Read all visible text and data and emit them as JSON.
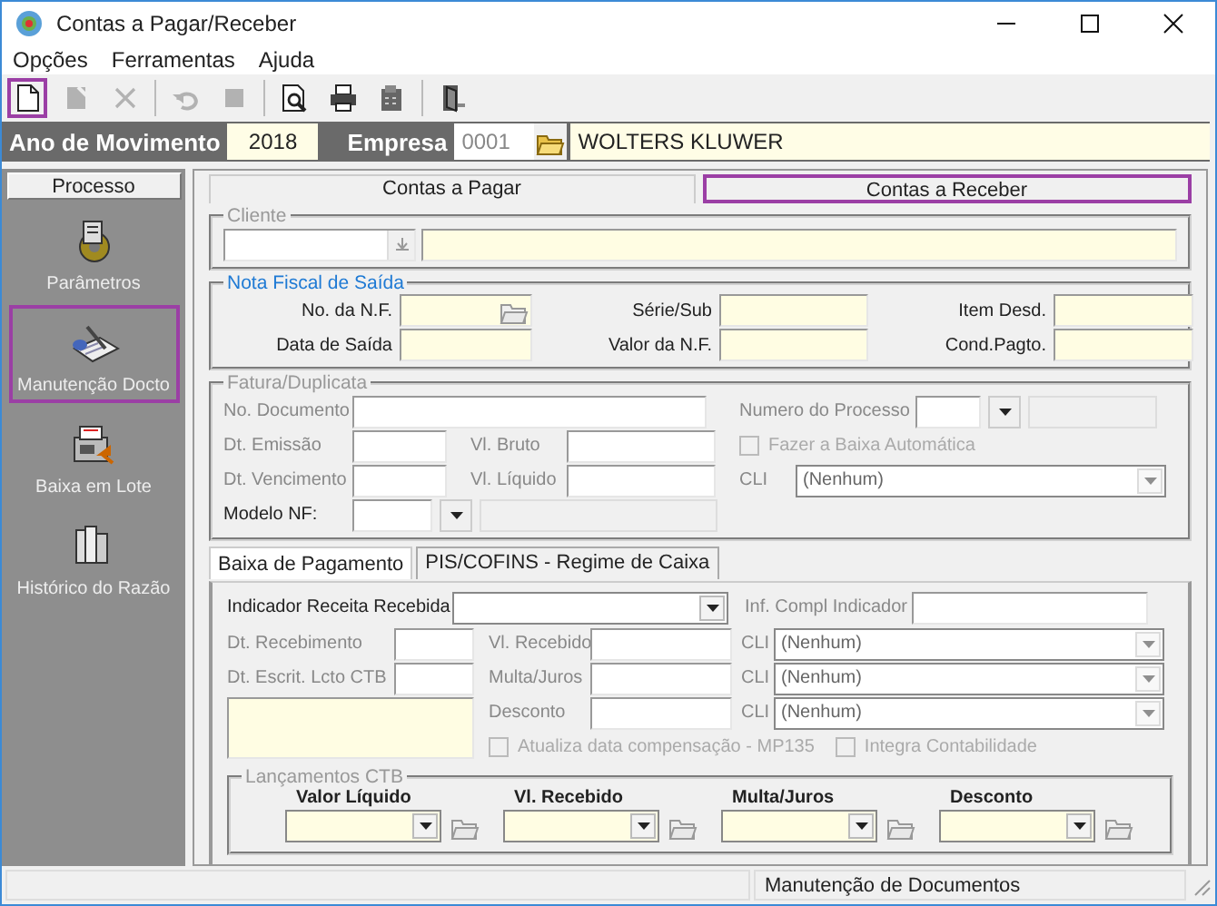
{
  "window": {
    "title": "Contas a Pagar/Receber"
  },
  "menu": [
    "Opções",
    "Ferramentas",
    "Ajuda"
  ],
  "toolbar": [
    {
      "kind": "new",
      "disabled": false,
      "selected": true
    },
    {
      "kind": "edit",
      "disabled": true,
      "selected": false
    },
    {
      "kind": "delete",
      "disabled": true,
      "selected": false
    },
    {
      "kind": "separator"
    },
    {
      "kind": "undo",
      "disabled": true,
      "selected": false
    },
    {
      "kind": "stop",
      "disabled": true,
      "selected": false
    },
    {
      "kind": "separator"
    },
    {
      "kind": "preview",
      "disabled": false,
      "selected": false
    },
    {
      "kind": "print",
      "disabled": false,
      "selected": false
    },
    {
      "kind": "calculator",
      "disabled": false,
      "selected": false
    },
    {
      "kind": "separator"
    },
    {
      "kind": "exit",
      "disabled": false,
      "selected": false
    }
  ],
  "header": {
    "year_label": "Ano de Movimento",
    "year": "2018",
    "company_label": "Empresa",
    "company_code": "0001",
    "company_name": "WOLTERS KLUWER"
  },
  "sidebar": {
    "title": "Processo",
    "items": [
      {
        "label": "Parâmetros",
        "kind": "gear",
        "selected": false
      },
      {
        "label": "Manutenção Docto",
        "kind": "notepad",
        "selected": true
      },
      {
        "label": "Baixa em Lote",
        "kind": "machine",
        "selected": false
      },
      {
        "label": "Histórico do Razão",
        "kind": "books",
        "selected": false
      }
    ]
  },
  "tabs": [
    {
      "label": "Contas a Pagar",
      "selected": false
    },
    {
      "label": "Contas a Receber",
      "selected": true
    }
  ],
  "cliente": {
    "legend": "Cliente",
    "disabled": true
  },
  "nota_fiscal": {
    "legend": "Nota Fiscal de Saída",
    "fields": [
      {
        "label": "No. da N.F."
      },
      {
        "label": "Série/Sub"
      },
      {
        "label": "Item Desd."
      },
      {
        "label": "Data de Saída"
      },
      {
        "label": "Valor da N.F."
      },
      {
        "label": "Cond.Pagto."
      }
    ]
  },
  "fatura": {
    "legend": "Fatura/Duplicata",
    "disabled": true,
    "document_label": "No. Documento",
    "process_label": "Numero do Processo",
    "issue_label": "Dt. Emissão",
    "gross_label": "Vl. Bruto",
    "auto_settle": {
      "label": "Fazer a Baixa Automática",
      "checked": false,
      "disabled": true
    },
    "due_label": "Dt. Vencimento",
    "net_label": "Vl. Líquido",
    "cli_label": "CLI",
    "cli_value": "(Nenhum)",
    "model_label": "Modelo NF:"
  },
  "sub_tabs": [
    {
      "label": "Baixa de Pagamento",
      "selected": true
    },
    {
      "label": "PIS/COFINS - Regime de Caixa",
      "selected": false
    }
  ],
  "baixa": {
    "indicator_label": "Indicador Receita Recebida",
    "compl_label": "Inf. Compl Indicador",
    "rows": [
      {
        "date_label": "Dt. Recebimento",
        "amount_label": "Vl. Recebido",
        "cli_label": "CLI",
        "cli_value": "(Nenhum)"
      },
      {
        "date_label": "Dt. Escrit. Lcto CTB",
        "amount_label": "Multa/Juros",
        "cli_label": "CLI",
        "cli_value": "(Nenhum)"
      },
      {
        "amount_label": "Desconto",
        "cli_label": "CLI",
        "cli_value": "(Nenhum)"
      }
    ],
    "update_check": {
      "label": "Atualiza data compensação - MP135",
      "checked": false,
      "disabled": true
    },
    "integrate_check": {
      "label": "Integra Contabilidade",
      "checked": false,
      "disabled": true
    },
    "ledger": {
      "legend": "Lançamentos CTB",
      "columns": [
        "Valor Líquido",
        "Vl. Recebido",
        "Multa/Juros",
        "Desconto"
      ]
    }
  },
  "status_bar": {
    "message": "Manutenção de Documentos"
  }
}
